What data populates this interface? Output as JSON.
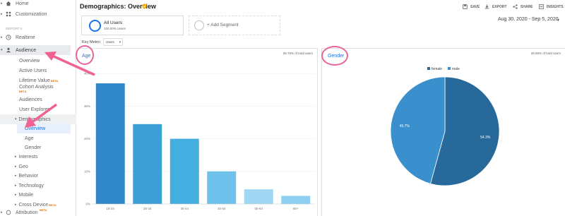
{
  "sidebar": {
    "home": "Home",
    "customization": "Customization",
    "reports_header": "REPORTS",
    "realtime": "Realtime",
    "audience": "Audience",
    "audience_items": {
      "overview": "Overview",
      "active_users": "Active Users",
      "lifetime_value": "Lifetime Value",
      "cohort_analysis": "Cohort Analysis",
      "audiences": "Audiences",
      "user_explorer": "User Explorer",
      "demographics": "Demographics",
      "demo_overview": "Overview",
      "demo_age": "Age",
      "demo_gender": "Gender",
      "interests": "Interests",
      "geo": "Geo",
      "behavior": "Behavior",
      "technology": "Technology",
      "mobile": "Mobile",
      "cross_device": "Cross Device"
    },
    "attribution": "Attribution",
    "beta": "BETA"
  },
  "header": {
    "title": "Demographics: Overview",
    "save": "SAVE",
    "export": "EXPORT",
    "share": "SHARE",
    "insights": "INSIGHTS"
  },
  "segments": {
    "all_users": "All Users",
    "all_users_pct": "100.00% Users",
    "add_segment": "+ Add Segment"
  },
  "date_range": "Aug 30, 2020 - Sep 5, 2020",
  "key_metric": {
    "label": "Key Metric:",
    "value": "Users"
  },
  "age_panel": {
    "title": "Age",
    "pct_text": "28.78% of total users"
  },
  "gender_panel": {
    "title": "Gender",
    "pct_text": "28.68% of total users"
  },
  "colors": {
    "accent": "#1a73e8",
    "annotation": "#e8649a"
  },
  "chart_data": [
    {
      "type": "bar",
      "categories": [
        "18-24",
        "25-34",
        "35-44",
        "45-54",
        "55-64",
        "65+"
      ],
      "values": [
        37,
        24.5,
        20,
        10,
        4.5,
        2.5
      ],
      "ylim": [
        0,
        42
      ],
      "yticks": [
        "40%",
        "30%",
        "20%",
        "10%",
        "0%"
      ],
      "ytick_values": [
        40,
        30,
        20,
        10,
        0
      ],
      "colors": [
        "#2f87c8",
        "#3c9fd6",
        "#45aee0",
        "#6ec1ea",
        "#8fd0f0",
        "#8fd0f0"
      ],
      "grid": true
    },
    {
      "type": "pie",
      "labels": [
        "female",
        "male"
      ],
      "values": [
        54.3,
        45.7
      ],
      "value_labels": [
        "54.3%",
        "45.7%"
      ],
      "colors": [
        "#26699a",
        "#3a8fcd"
      ],
      "legend": "top"
    }
  ]
}
